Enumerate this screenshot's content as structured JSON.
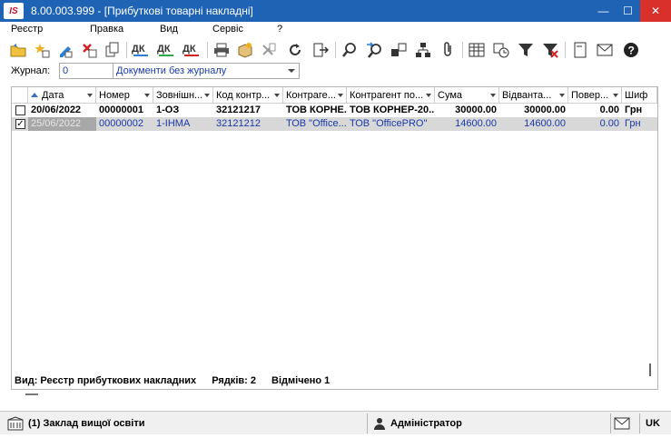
{
  "window": {
    "logo": "IS",
    "title": "8.00.003.999 - [Прибуткові товарні накладні]",
    "minimize": "—",
    "maximize": "☐",
    "close": "✕",
    "brand_color": "#1f64b4",
    "close_color": "#d9302c"
  },
  "menu": {
    "items": [
      "Реєстр",
      "Правка",
      "Вид",
      "Сервіс",
      "?"
    ]
  },
  "toolbar": {
    "icons": [
      "open-folder-icon",
      "new-star-icon",
      "edit-pencil-icon",
      "delete-icon",
      "copy-icon",
      "post-dk-icon",
      "post-dk-green-icon",
      "post-dk-red-icon",
      "print-icon",
      "package-icon",
      "export-icon",
      "refresh-icon",
      "exit-icon",
      "search-icon",
      "search-next-icon",
      "link-icon",
      "tree-icon",
      "attach-icon",
      "table-icon",
      "schedule-icon",
      "filter-icon",
      "clear-filter-icon",
      "window-icon",
      "mail-icon",
      "help-icon"
    ]
  },
  "journal": {
    "label": "Журнал:",
    "number": "0",
    "selected": "Документи без журналу"
  },
  "grid": {
    "columns": [
      "Дата",
      "Номер",
      "Зовнішн...",
      "Код контр...",
      "Контраге...",
      "Контрагент по...",
      "Сума",
      "Відванта...",
      "Повер...",
      "Шиф"
    ],
    "rows": [
      {
        "checked": "",
        "cells": [
          "20/06/2022",
          "00000001",
          "1-ОЗ",
          "32121217",
          "ТОВ КОРНЕ...",
          "ТОВ КОРНЕР-20...",
          "30000.00",
          "30000.00",
          "0.00",
          "Грн"
        ]
      },
      {
        "checked": "✓",
        "cells": [
          "25/06/2022",
          "00000002",
          "1-ІНМА",
          "32121212",
          "ТОВ \"Office...",
          "ТОВ \"OfficePRO\"",
          "14600.00",
          "14600.00",
          "0.00",
          "Грн"
        ]
      }
    ],
    "status": {
      "view": "Вид: Реєстр прибуткових накладних",
      "rows": "Рядків: 2",
      "marked": "Відмічено 1"
    }
  },
  "statusbar": {
    "org": "(1) Заклад вищої освіти",
    "user": "Адміністратор",
    "lang": "UK"
  }
}
